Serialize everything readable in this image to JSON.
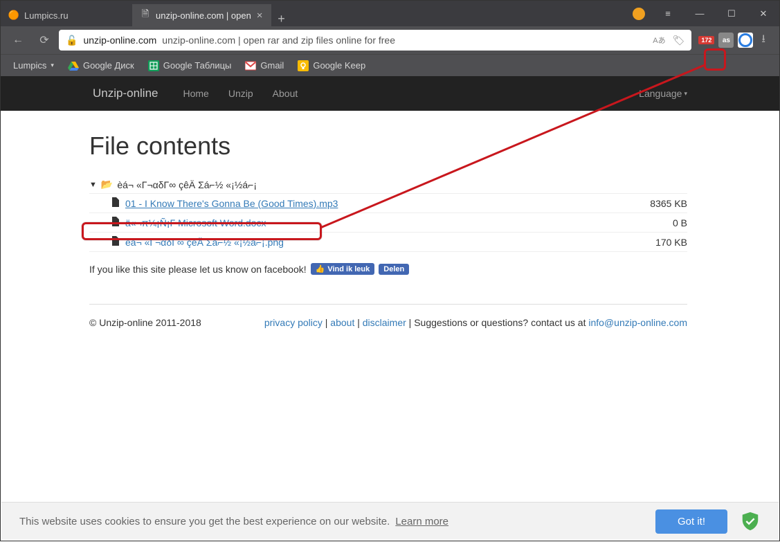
{
  "tabs": [
    {
      "title": "Lumpics.ru"
    },
    {
      "title": "unzip-online.com | open"
    }
  ],
  "url": {
    "domain": "unzip-online.com",
    "title": "unzip-online.com | open rar and zip files online for free",
    "translate": "Aあ"
  },
  "ext_badge": "172",
  "bookmarks": [
    {
      "label": "Lumpics",
      "caret": "▾"
    },
    {
      "label": "Google Диск"
    },
    {
      "label": "Google Таблицы"
    },
    {
      "label": "Gmail"
    },
    {
      "label": "Google Keep"
    }
  ],
  "nav": {
    "brand": "Unzip-online",
    "home": "Home",
    "unzip": "Unzip",
    "about": "About",
    "lang": "Language"
  },
  "page": {
    "heading": "File contents",
    "folder": "èá¬ «Γ¬αδΓ∞ çêÄ Σá⌐½ «¡½á⌐¡",
    "files": [
      {
        "name": "01 - I Know There's Gonna Be (Good Times).mp3",
        "size": "8365 KB"
      },
      {
        "name": "ä«¬π¼¡Ñ¡Γ Microsoft Word.docx",
        "size": "0 B"
      },
      {
        "name": "èá¬ «Γ¬αδΓ∞ çêÄ Σá⌐½ «¡½á⌐¡.png",
        "size": "170 KB"
      }
    ],
    "fb_text": "If you like this site please let us know on facebook!",
    "fb_like": "Vind ik leuk",
    "fb_share": "Delen"
  },
  "footer": {
    "copyright": "© Unzip-online 2011-2018",
    "privacy": "privacy policy",
    "about": "about",
    "disclaimer": "disclaimer",
    "suggest": "Suggestions or questions? contact us at ",
    "email": "info@unzip-online.com"
  },
  "cookie": {
    "text": "This website uses cookies to ensure you get the best experience on our website.",
    "learn": "Learn more",
    "gotit": "Got it!"
  }
}
